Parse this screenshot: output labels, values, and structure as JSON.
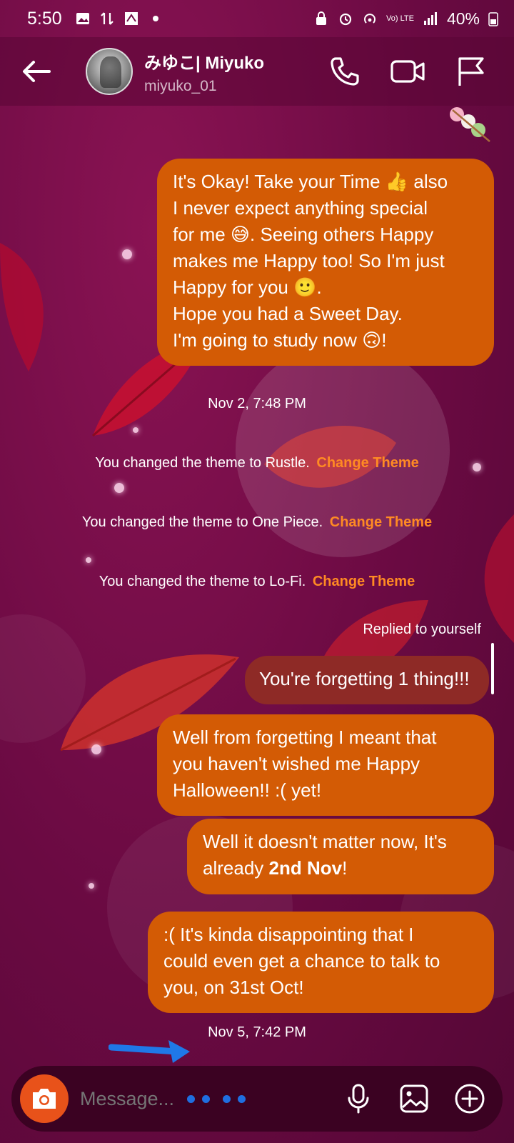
{
  "status_bar": {
    "time": "5:50",
    "network_label": "Vo) LTE",
    "battery_percent": "40%"
  },
  "header": {
    "contact_name": "みゆこ| Miyuko",
    "contact_handle": "miyuko_01"
  },
  "messages": {
    "m1_lines": [
      "It's Okay! Take your Time 👍 also",
      "I never expect anything special",
      "for me 😅. Seeing others Happy",
      "makes me Happy too! So I'm just",
      "Happy for you 🙂.",
      "Hope you had a Sweet Day.",
      "I'm going to study now 🙃!"
    ],
    "timestamp_1": "Nov 2, 7:48 PM",
    "events": [
      {
        "text": "You changed the theme to Rustle.",
        "link": "Change Theme"
      },
      {
        "text": "You changed the theme to One Piece.",
        "link": "Change Theme"
      },
      {
        "text": "You changed the theme to Lo-Fi.",
        "link": "Change Theme"
      }
    ],
    "replied_label": "Replied to yourself",
    "reply_quote": "You're forgetting 1 thing!!!",
    "m2_lines": [
      "Well from forgetting I meant that",
      "you haven't wished me Happy",
      "Halloween!! :( yet!"
    ],
    "m3_line1": "Well it doesn't matter now, It's",
    "m3_prefix": "already ",
    "m3_bold": "2nd Nov",
    "m3_suffix": "!",
    "m4_lines": [
      ":( It's kinda disappointing that I",
      "could even get a chance to talk to",
      "you, on 31st Oct!"
    ],
    "timestamp_2": "Nov 5, 7:42 PM"
  },
  "composer": {
    "placeholder": "Message..."
  },
  "colors": {
    "bubble": "#d35b05",
    "reply_bubble": "#8e2a26",
    "link": "#ff8a23",
    "background": "#6e0a44"
  },
  "icons": [
    "back-arrow-icon",
    "phone-icon",
    "video-icon",
    "flag-icon",
    "camera-icon",
    "microphone-icon",
    "gallery-icon",
    "plus-circle-icon"
  ]
}
